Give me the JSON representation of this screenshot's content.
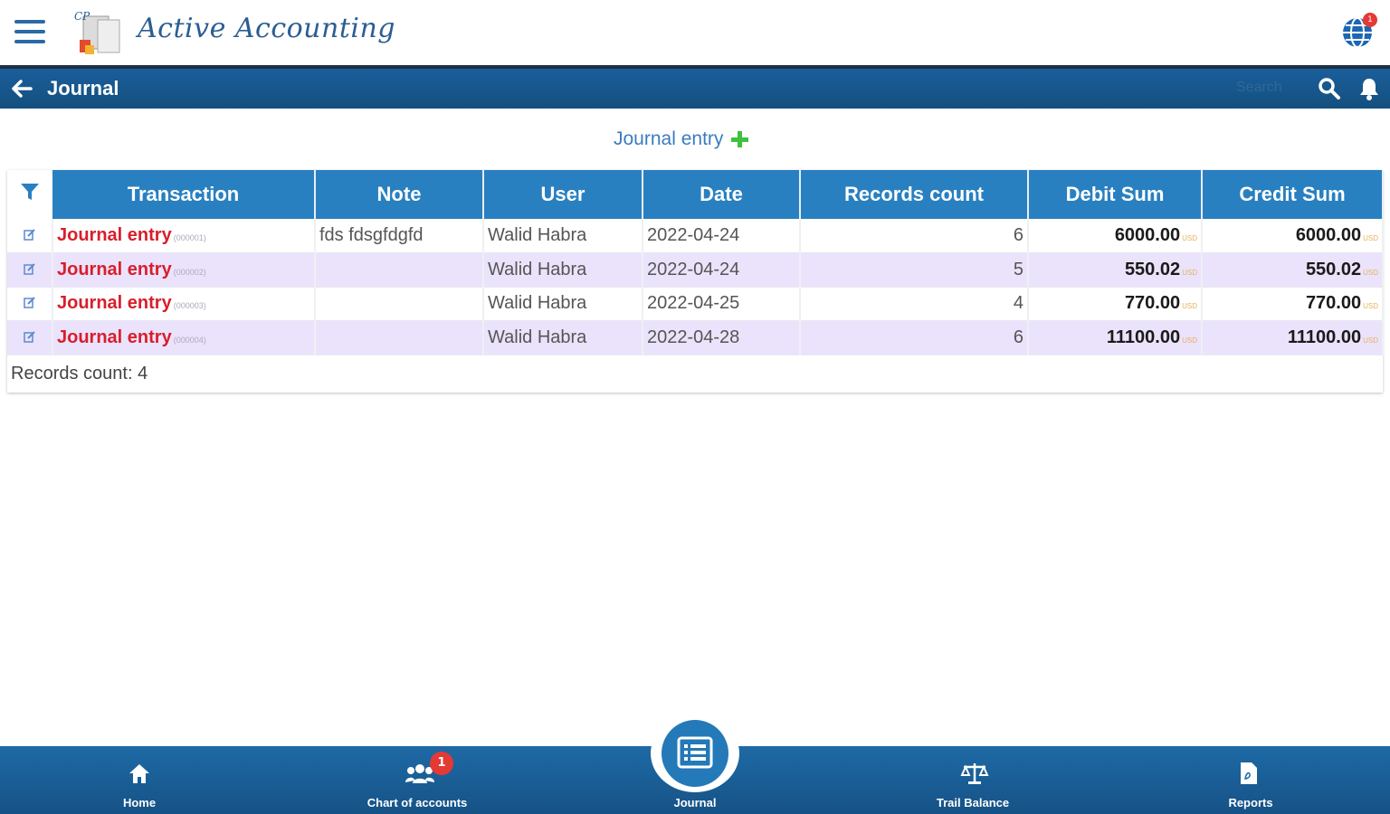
{
  "app": {
    "title": "Active Accounting",
    "notification_badge": "1"
  },
  "pagebar": {
    "title": "Journal",
    "search_placeholder": "Search"
  },
  "new_entry": {
    "label": "Journal entry"
  },
  "table": {
    "columns": [
      "Transaction",
      "Note",
      "User",
      "Date",
      "Records count",
      "Debit Sum",
      "Credit Sum"
    ],
    "rows": [
      {
        "transaction": "Journal entry",
        "number": "(000001)",
        "note": "fds fdsgfdgfd",
        "user": "Walid Habra",
        "date": "2022-04-24",
        "records": "6",
        "debit": "6000.00",
        "credit": "6000.00"
      },
      {
        "transaction": "Journal entry",
        "number": "(000002)",
        "note": "",
        "user": "Walid Habra",
        "date": "2022-04-24",
        "records": "5",
        "debit": "550.02",
        "credit": "550.02"
      },
      {
        "transaction": "Journal entry",
        "number": "(000003)",
        "note": "",
        "user": "Walid Habra",
        "date": "2022-04-25",
        "records": "4",
        "debit": "770.00",
        "credit": "770.00"
      },
      {
        "transaction": "Journal entry",
        "number": "(000004)",
        "note": "",
        "user": "Walid Habra",
        "date": "2022-04-28",
        "records": "6",
        "debit": "11100.00",
        "credit": "11100.00"
      }
    ],
    "currency": "USD",
    "records_count_label": "Records count:",
    "records_count_value": "4"
  },
  "bottom_nav": {
    "home": "Home",
    "chart_of_accounts": "Chart of accounts",
    "chart_badge": "1",
    "journal": "Journal",
    "trial_balance": "Trail Balance",
    "reports": "Reports"
  }
}
